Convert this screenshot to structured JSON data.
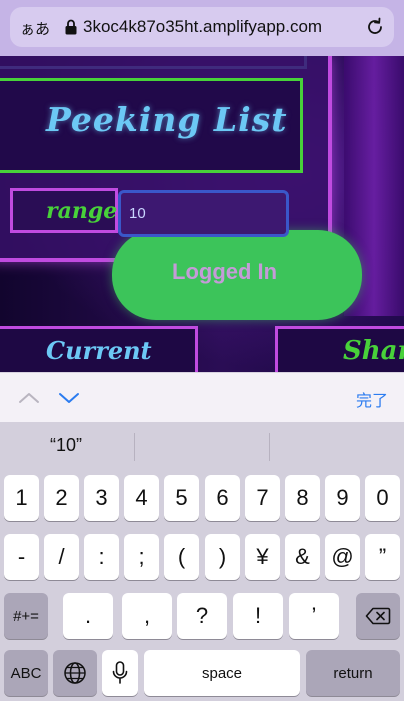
{
  "browser": {
    "text_size_label": "ぁあ",
    "url": "3koc4k87o35ht.amplifyapp.com"
  },
  "page": {
    "title": "Peeking List",
    "range_label": "range",
    "range_value": "10",
    "logged_in_label": "Logged In",
    "current_label": "Current",
    "share_label": "Shar"
  },
  "accessory_bar": {
    "done_label": "完了"
  },
  "keyboard": {
    "suggestion": "“10”",
    "row1": [
      "1",
      "2",
      "3",
      "4",
      "5",
      "6",
      "7",
      "8",
      "9",
      "0"
    ],
    "row2": [
      "-",
      "/",
      ":",
      ";",
      "(",
      ")",
      "¥",
      "&",
      "@",
      "”"
    ],
    "row3": {
      "shift_label": "#+=",
      "keys": [
        ".",
        ",",
        "?",
        "!",
        "’"
      ]
    },
    "row4": {
      "abc_label": "ABC",
      "space_label": "space",
      "return_label": "return"
    }
  },
  "colors": {
    "neon_green": "#48d13a",
    "neon_blue": "#6cc8f5",
    "neon_purple": "#c04be0",
    "ios_blue": "#2b7cf0"
  }
}
